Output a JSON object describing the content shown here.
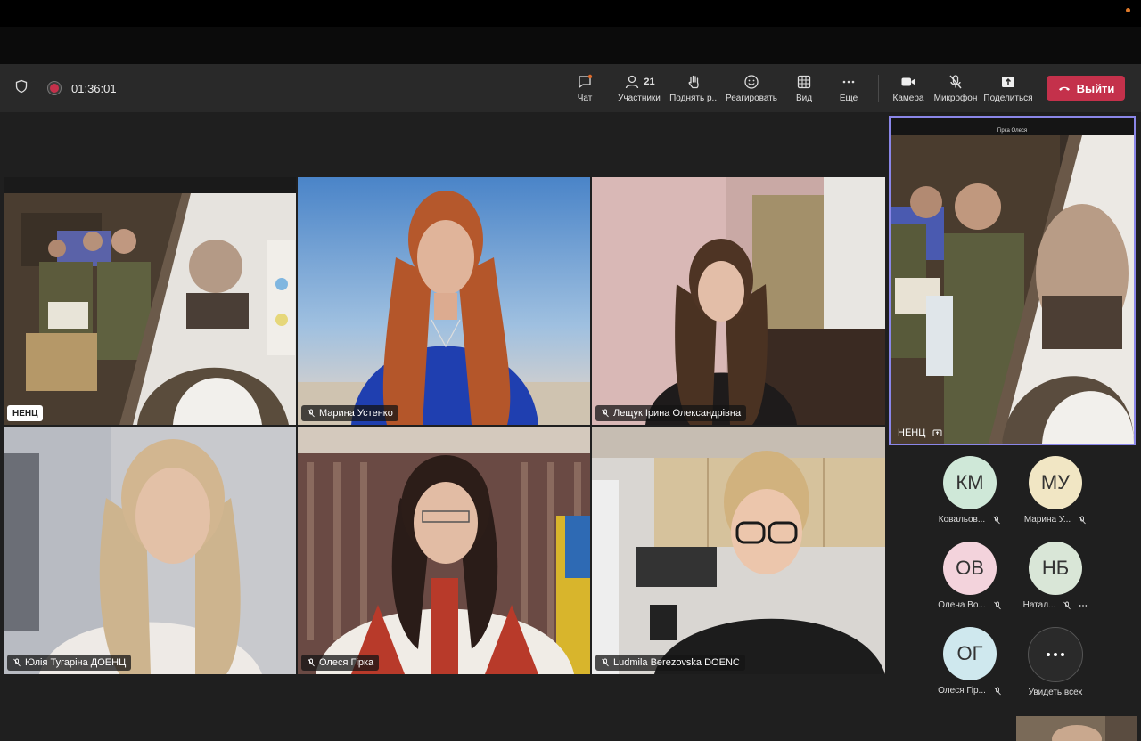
{
  "meeting": {
    "timer": "01:36:01"
  },
  "toolbar": {
    "chat": "Чат",
    "participants": "Участники",
    "participants_count": "21",
    "raise_hand": "Поднять р...",
    "react": "Реагировать",
    "view": "Вид",
    "more": "Еще",
    "camera": "Камера",
    "mic": "Микрофон",
    "share": "Поделиться",
    "leave": "Выйти"
  },
  "tiles": [
    {
      "name": "НЕНЦ"
    },
    {
      "name": "Марина Устенко"
    },
    {
      "name": "Лещук Ірина Олександрівна"
    },
    {
      "name": "Юлія Тугаріна ДОЕНЦ"
    },
    {
      "name": "Олеся Гірка"
    },
    {
      "name": "Ludmila Berezovska DOENC"
    }
  ],
  "spotlight": {
    "title": "Гірка Олеся",
    "name": "НЕНЦ"
  },
  "roster": [
    {
      "initials": "КМ",
      "name": "Ковальов...",
      "color": "#cfe8d8"
    },
    {
      "initials": "МУ",
      "name": "Марина У...",
      "color": "#f1e6c4"
    },
    {
      "initials": "ОВ",
      "name": "Олена Во...",
      "color": "#f3d3dc"
    },
    {
      "initials": "НБ",
      "name": "Натал...",
      "color": "#d9e6d7"
    },
    {
      "initials": "ОГ",
      "name": "Олеся Гір...",
      "color": "#cfe8ee"
    }
  ],
  "see_all": "Увидеть всех",
  "colors": {
    "leave": "#c4314b",
    "spotlight_border": "#8a86e8",
    "toolbar": "#292929"
  }
}
